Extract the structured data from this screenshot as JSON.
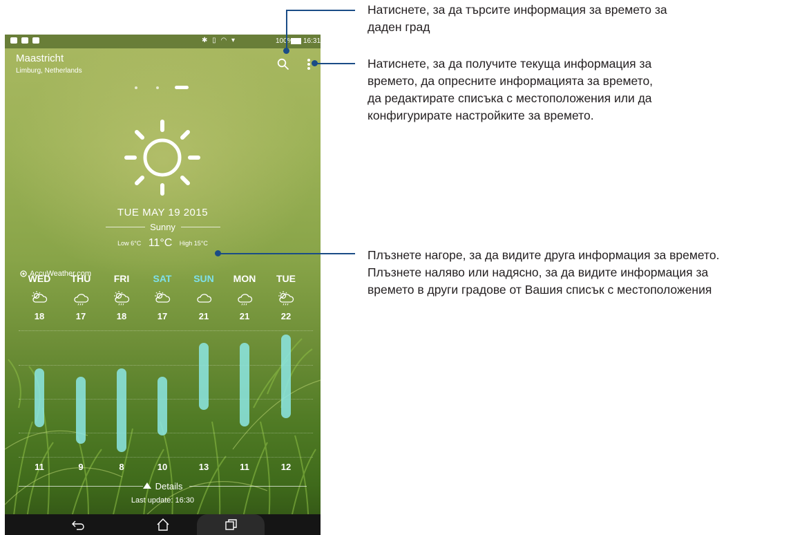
{
  "status_bar": {
    "battery_percent": "100%",
    "time": "16:31"
  },
  "location": {
    "city": "Maastricht",
    "region": "Limburg, Netherlands"
  },
  "icons": {
    "search": "search-icon",
    "menu": "more-vert-icon",
    "weather": "sun-icon"
  },
  "current": {
    "date": "TUE MAY 19 2015",
    "condition": "Sunny",
    "low": "Low 6°C",
    "temp": "11°C",
    "high": "High 15°C"
  },
  "provider": "AccuWeather.com",
  "forecast": [
    {
      "day": "WED",
      "icon": "sun-cloud-icon",
      "high": "18",
      "low": "11",
      "weekend": false
    },
    {
      "day": "THU",
      "icon": "rain-cloud-icon",
      "high": "17",
      "low": "9",
      "weekend": false
    },
    {
      "day": "FRI",
      "icon": "sun-rain-icon",
      "high": "18",
      "low": "8",
      "weekend": false
    },
    {
      "day": "SAT",
      "icon": "sun-cloud-icon",
      "high": "17",
      "low": "10",
      "weekend": true
    },
    {
      "day": "SUN",
      "icon": "cloud-icon",
      "high": "21",
      "low": "13",
      "weekend": true
    },
    {
      "day": "MON",
      "icon": "rain-cloud-icon",
      "high": "21",
      "low": "11",
      "weekend": false
    },
    {
      "day": "TUE",
      "icon": "sun-rain-icon",
      "high": "22",
      "low": "12",
      "weekend": false
    }
  ],
  "footer": {
    "details": "Details",
    "last_update": "Last update: 16:30"
  },
  "nav": {
    "back": "back-icon",
    "home": "home-icon",
    "recents": "recents-icon"
  },
  "annotations": {
    "search": "Натиснете, за да търсите информация за времето за даден град",
    "menu": "Натиснете, за да получите текуща информация за времето, да опресните информацията за времето, да редактирате списъка с местоположения или да конфигурирате настройките за времето.",
    "swipe": "Плъзнете нагоре, за да видите друга информация за времето. Плъзнете наляво или надясно, за да видите информация за времето в други градове от Вашия списък с местоположения"
  },
  "colors": {
    "accent_callout": "#1a4c86",
    "bar": "#8ce6e4",
    "weekend": "#7fe0ea"
  }
}
